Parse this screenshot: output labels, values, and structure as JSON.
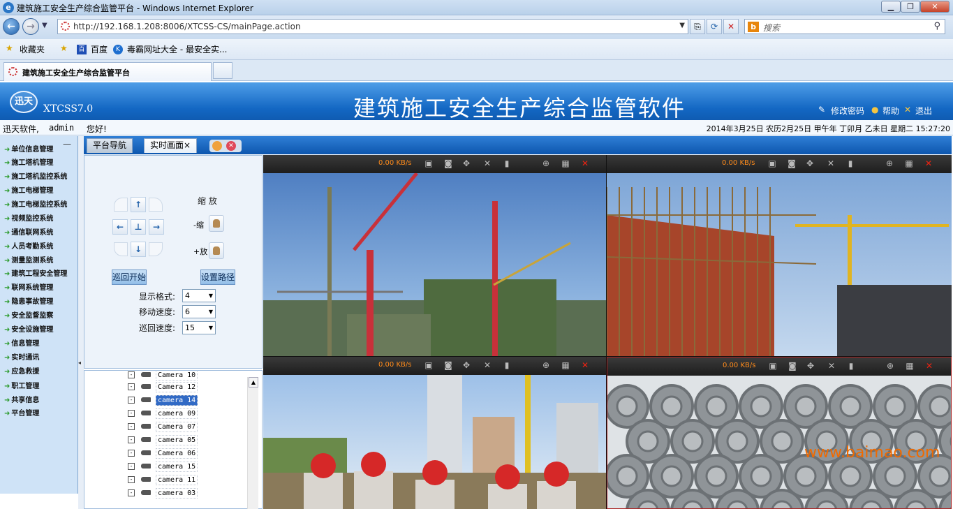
{
  "browser": {
    "window_title": "建筑施工安全生产综合监管平台 - Windows Internet Explorer",
    "address": "http://192.168.1.208:8006/XTCSS-CS/mainPage.action",
    "search_placeholder": "搜索",
    "favorites_label": "收藏夹",
    "favorites": [
      "百度",
      "毒霸网址大全 - 最安全实..."
    ],
    "tab_title": "建筑施工安全生产综合监管平台"
  },
  "app": {
    "logo_text": "迅天",
    "version": "XTCSS7.0",
    "title": "建筑施工安全生产综合监管软件",
    "links": {
      "change_password": "修改密码",
      "help": "帮助",
      "logout": "退出"
    },
    "user_company": "迅天软件,",
    "user_name": "admin",
    "greeting": "您好!",
    "datetime": "2014年3月25日 农历2月25日 甲午年 丁卯月 乙未日 星期二 15:27:20"
  },
  "sidebar": {
    "items": [
      "单位信息管理",
      "施工塔机管理",
      "施工塔机监控系统",
      "施工电梯管理",
      "施工电梯监控系统",
      "视频监控系统",
      "通信联网系统",
      "人员考勤系统",
      "测量监测系统",
      "建筑工程安全管理",
      "联网系统管理",
      "隐患事故管理",
      "安全监督监察",
      "安全设施管理",
      "信息管理",
      "实时通讯",
      "应急救援",
      "职工管理",
      "共享信息",
      "平台管理"
    ]
  },
  "main_tabs": [
    "平台导航",
    "实时画面×"
  ],
  "ptz": {
    "zoom_label": "缩 放",
    "zoom_out": "-缩",
    "zoom_in": "+放",
    "patrol_start": "巡回开始",
    "set_path": "设置路径",
    "display_format_label": "显示格式:",
    "display_format": "4",
    "move_speed_label": "移动速度:",
    "move_speed": "6",
    "patrol_speed_label": "巡回速度:",
    "patrol_speed": "15"
  },
  "cameras": [
    "Camera 10",
    "Camera 12",
    "camera 14",
    "camera 09",
    "Camera 07",
    "camera 05",
    "Camera 06",
    "camera 15",
    "camera 11",
    "camera 03"
  ],
  "selected_camera": "camera 14",
  "video_panes": [
    {
      "rate": "0.00 KB/s",
      "scene": "cranes"
    },
    {
      "rate": "0.00 KB/s",
      "scene": "brick-wall"
    },
    {
      "rate": "0.00 KB/s",
      "scene": "workers"
    },
    {
      "rate": "0.00 KB/s",
      "scene": "steel-coils"
    }
  ],
  "watermark": "www.baimao.com",
  "colors": {
    "header_blue": "#1367c3",
    "sidebar_bg": "#cfe3f7",
    "rate_orange": "#ff8b1a"
  }
}
